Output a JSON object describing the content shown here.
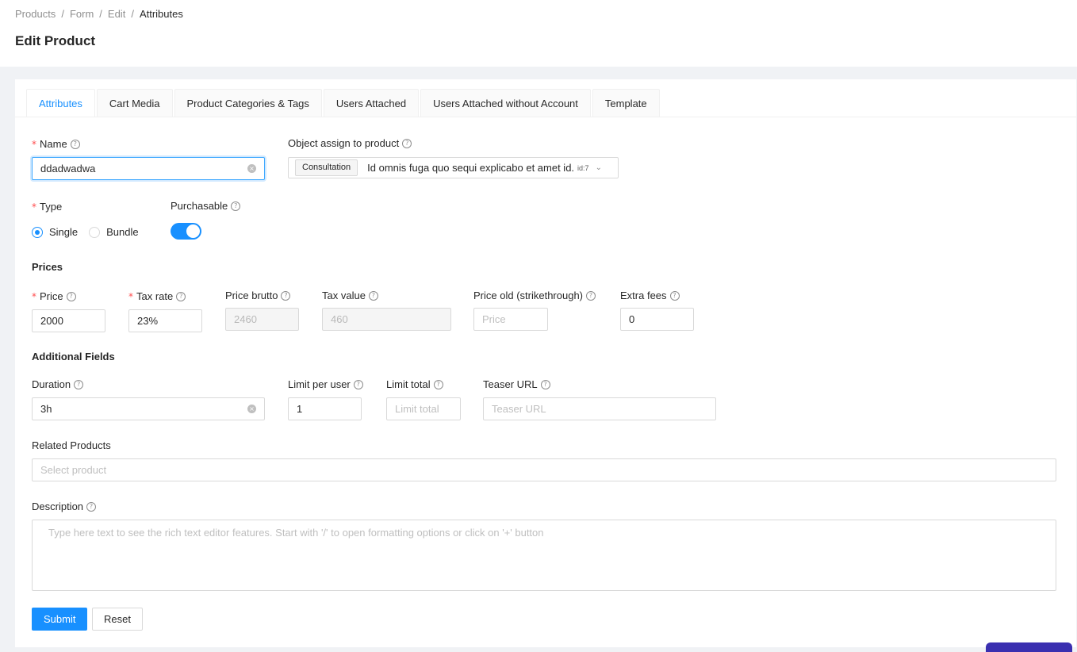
{
  "breadcrumb": [
    "Products",
    "Form",
    "Edit",
    "Attributes"
  ],
  "page_title": "Edit Product",
  "tabs": [
    "Attributes",
    "Cart Media",
    "Product Categories & Tags",
    "Users Attached",
    "Users Attached without Account",
    "Template"
  ],
  "active_tab": "Attributes",
  "form": {
    "name": {
      "label": "Name",
      "value": "ddadwadwa"
    },
    "object_assign": {
      "label": "Object assign to product",
      "tag": "Consultation",
      "value": "Id omnis fuga quo sequi explicabo et amet id.",
      "id": "id:7"
    },
    "type": {
      "label": "Type",
      "options": [
        "Single",
        "Bundle"
      ],
      "selected": "Single"
    },
    "purchasable": {
      "label": "Purchasable",
      "on": true
    },
    "prices_title": "Prices",
    "price": {
      "label": "Price",
      "value": "2000"
    },
    "tax_rate": {
      "label": "Tax rate",
      "value": "23%"
    },
    "price_brutto": {
      "label": "Price brutto",
      "value": "2460"
    },
    "tax_value": {
      "label": "Tax value",
      "value": "460"
    },
    "price_old": {
      "label": "Price old (strikethrough)",
      "placeholder": "Price"
    },
    "extra_fees": {
      "label": "Extra fees",
      "value": "0"
    },
    "additional_title": "Additional Fields",
    "duration": {
      "label": "Duration",
      "value": "3h"
    },
    "limit_per_user": {
      "label": "Limit per user",
      "value": "1"
    },
    "limit_total": {
      "label": "Limit total",
      "placeholder": "Limit total"
    },
    "teaser_url": {
      "label": "Teaser URL",
      "placeholder": "Teaser URL"
    },
    "related_products": {
      "label": "Related Products",
      "placeholder": "Select product"
    },
    "description": {
      "label": "Description",
      "placeholder": "Type here text to see the rich text editor features. Start with '/' to open formatting options or click on '+' button"
    },
    "submit_label": "Submit",
    "reset_label": "Reset"
  },
  "colors": {
    "primary": "#1890ff",
    "required": "#ff4d4f",
    "background": "#f0f2f5"
  }
}
